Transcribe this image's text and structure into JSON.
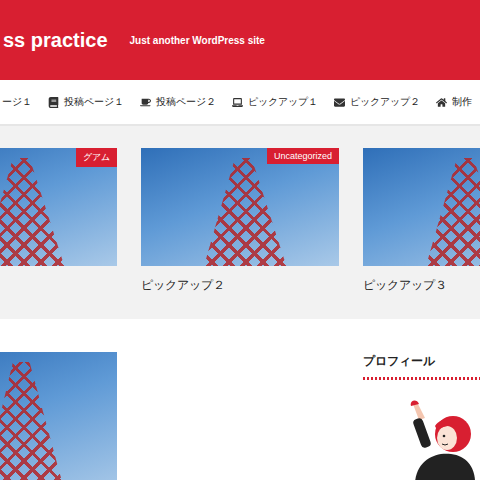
{
  "header": {
    "title": "ss practice",
    "tagline": "Just another WordPress site"
  },
  "nav": {
    "items": [
      {
        "label": "ージ１"
      },
      {
        "label": "投稿ページ１"
      },
      {
        "label": "投稿ページ２"
      },
      {
        "label": "ピックアップ１"
      },
      {
        "label": "ピックアップ２"
      },
      {
        "label": "制作"
      }
    ]
  },
  "pickups": [
    {
      "badge": "グアム"
    },
    {
      "badge": "Uncategorized",
      "title": "ピックアップ２"
    },
    {
      "title": "ピックアップ３"
    }
  ],
  "sidebar": {
    "heading": "プロフィール"
  }
}
